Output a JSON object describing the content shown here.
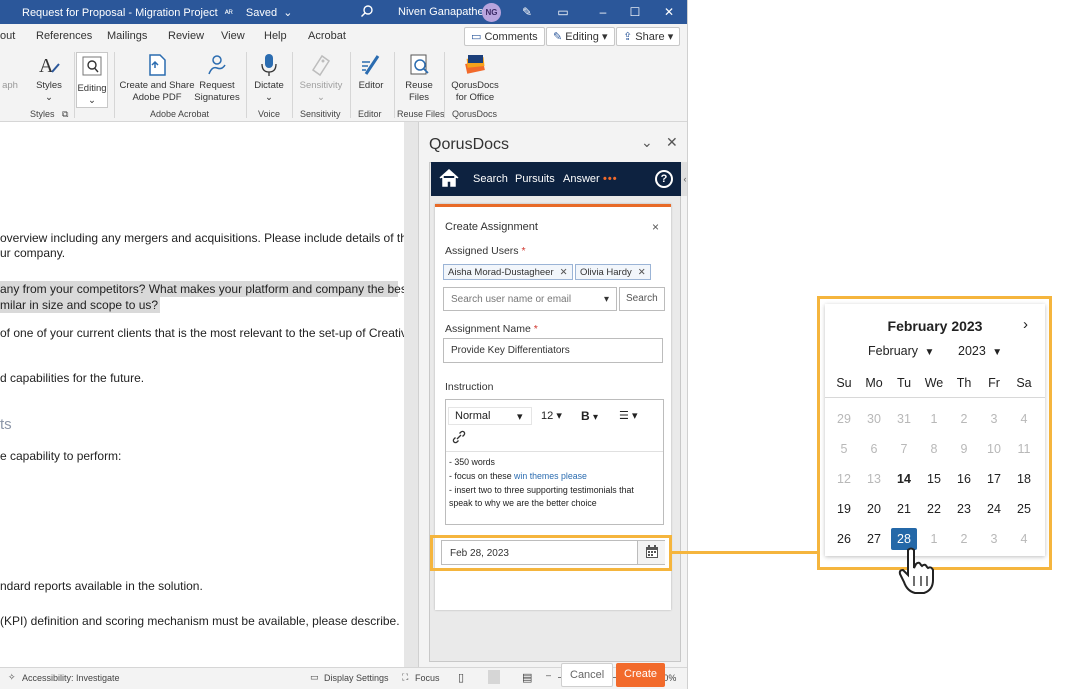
{
  "titlebar": {
    "doc_title": "Request for Proposal - Migration Project",
    "saved": "Saved",
    "user_name": "Niven Ganapathee",
    "user_initials": "NG"
  },
  "menubar": {
    "tabs": [
      "out",
      "References",
      "Mailings",
      "Review",
      "View",
      "Help",
      "Acrobat"
    ],
    "comments": "Comments",
    "editing": "Editing",
    "share": "Share"
  },
  "ribbon": {
    "buttons": {
      "aph": "aph",
      "styles": "Styles",
      "editing": "Editing",
      "create_share_1": "Create and Share",
      "create_share_2": "Adobe PDF",
      "request_sig_1": "Request",
      "request_sig_2": "Signatures",
      "dictate": "Dictate",
      "sensitivity": "Sensitivity",
      "editor": "Editor",
      "reuse_1": "Reuse",
      "reuse_2": "Files",
      "qorus_1": "QorusDocs",
      "qorus_2": "for Office"
    },
    "groups": {
      "styles": "Styles",
      "adobe": "Adobe Acrobat",
      "voice": "Voice",
      "sensitivity": "Sensitivity",
      "editor": "Editor",
      "reuse": "Reuse Files",
      "qorus": "QorusDocs"
    }
  },
  "document": {
    "lines": [
      "overview including any mergers and acquisitions. Please include details of the",
      "ur company.",
      "any from your competitors? What makes your platform and company the best",
      "milar in size and scope to us?",
      "of one of your current clients that is the most relevant to the set-up of Creative",
      "d capabilities for the future.",
      "ts",
      "e capability to perform:",
      "ndard reports available in the solution.",
      "(KPI) definition and scoring mechanism must be available, please describe."
    ]
  },
  "statusbar": {
    "accessibility": "Accessibility: Investigate",
    "display_settings": "Display Settings",
    "focus": "Focus",
    "zoom": "110%"
  },
  "qorus": {
    "title": "QorusDocs",
    "nav": {
      "search": "Search",
      "pursuits": "Pursuits",
      "answer": "Answer",
      "dots": "•••",
      "help": "?"
    },
    "card": {
      "title": "Create Assignment",
      "assigned_users_label": "Assigned Users",
      "required_mark": "*",
      "users": [
        "Aisha Morad-Dustagheer",
        "Olivia Hardy"
      ],
      "search_placeholder": "Search user name or email",
      "search_button": "Search",
      "assignment_name_label": "Assignment Name",
      "assignment_name_value": "Provide Key Differentiators",
      "instruction_label": "Instruction",
      "toolbar": {
        "style": "Normal",
        "size": "12",
        "bold": "B"
      },
      "instruction_lines": [
        "- 350 words",
        "- focus on these ",
        "win themes please",
        "- insert two to three supporting testimonials that",
        "speak to why we are the better choice"
      ],
      "due_date": "Feb 28, 2023",
      "cancel": "Cancel",
      "create": "Create"
    }
  },
  "calendar": {
    "header": "February 2023",
    "month_select": "February",
    "year_select": "2023",
    "weekdays": [
      "Su",
      "Mo",
      "Tu",
      "We",
      "Th",
      "Fr",
      "Sa"
    ],
    "weeks": [
      [
        "29",
        "30",
        "31",
        "1",
        "2",
        "3",
        "4"
      ],
      [
        "5",
        "6",
        "7",
        "8",
        "9",
        "10",
        "11"
      ],
      [
        "12",
        "13",
        "14",
        "15",
        "16",
        "17",
        "18"
      ],
      [
        "19",
        "20",
        "21",
        "22",
        "23",
        "24",
        "25"
      ],
      [
        "26",
        "27",
        "28",
        "1",
        "2",
        "3",
        "4"
      ]
    ],
    "muted_rows": [
      0,
      1
    ],
    "muted_cells": [
      [
        2,
        0
      ],
      [
        2,
        1
      ],
      [
        4,
        3
      ],
      [
        4,
        4
      ],
      [
        4,
        5
      ],
      [
        4,
        6
      ]
    ],
    "today_cell": [
      2,
      2
    ],
    "selected_cell": [
      4,
      2
    ]
  },
  "colors": {
    "word_blue": "#2b579a",
    "qorus_navy": "#0d2240",
    "accent_orange": "#e86a28",
    "highlight_yellow": "#f5b53d",
    "selected_blue": "#2468a8"
  }
}
